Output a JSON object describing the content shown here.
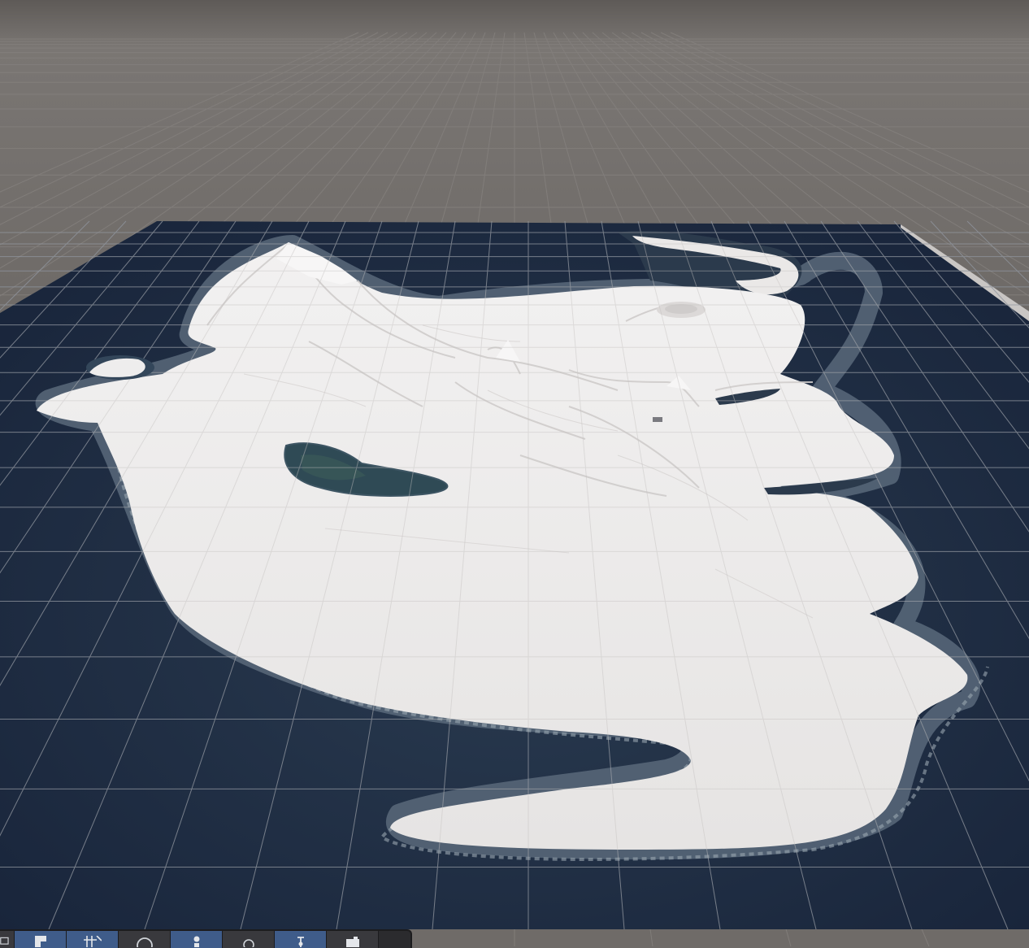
{
  "scene": {
    "sky_color": "#6f6b68",
    "ground_grid_color": "#8a8683",
    "ocean_color": "#1c2a3d",
    "terrain_color": "#ecebea",
    "terrain_shadow_color": "#cfcccb",
    "shore_color": "#3c4a55"
  },
  "toolbar": {
    "buttons": [
      {
        "name": "image-icon",
        "active": false
      },
      {
        "name": "shading-mode-icon",
        "active": true
      },
      {
        "name": "grid-snap-icon",
        "active": true
      },
      {
        "name": "orbit-icon",
        "active": false
      },
      {
        "name": "light-icon",
        "active": true
      },
      {
        "name": "search-icon",
        "active": false
      },
      {
        "name": "transform-gizmo-icon",
        "active": true
      },
      {
        "name": "camera-icon",
        "active": false
      }
    ]
  }
}
